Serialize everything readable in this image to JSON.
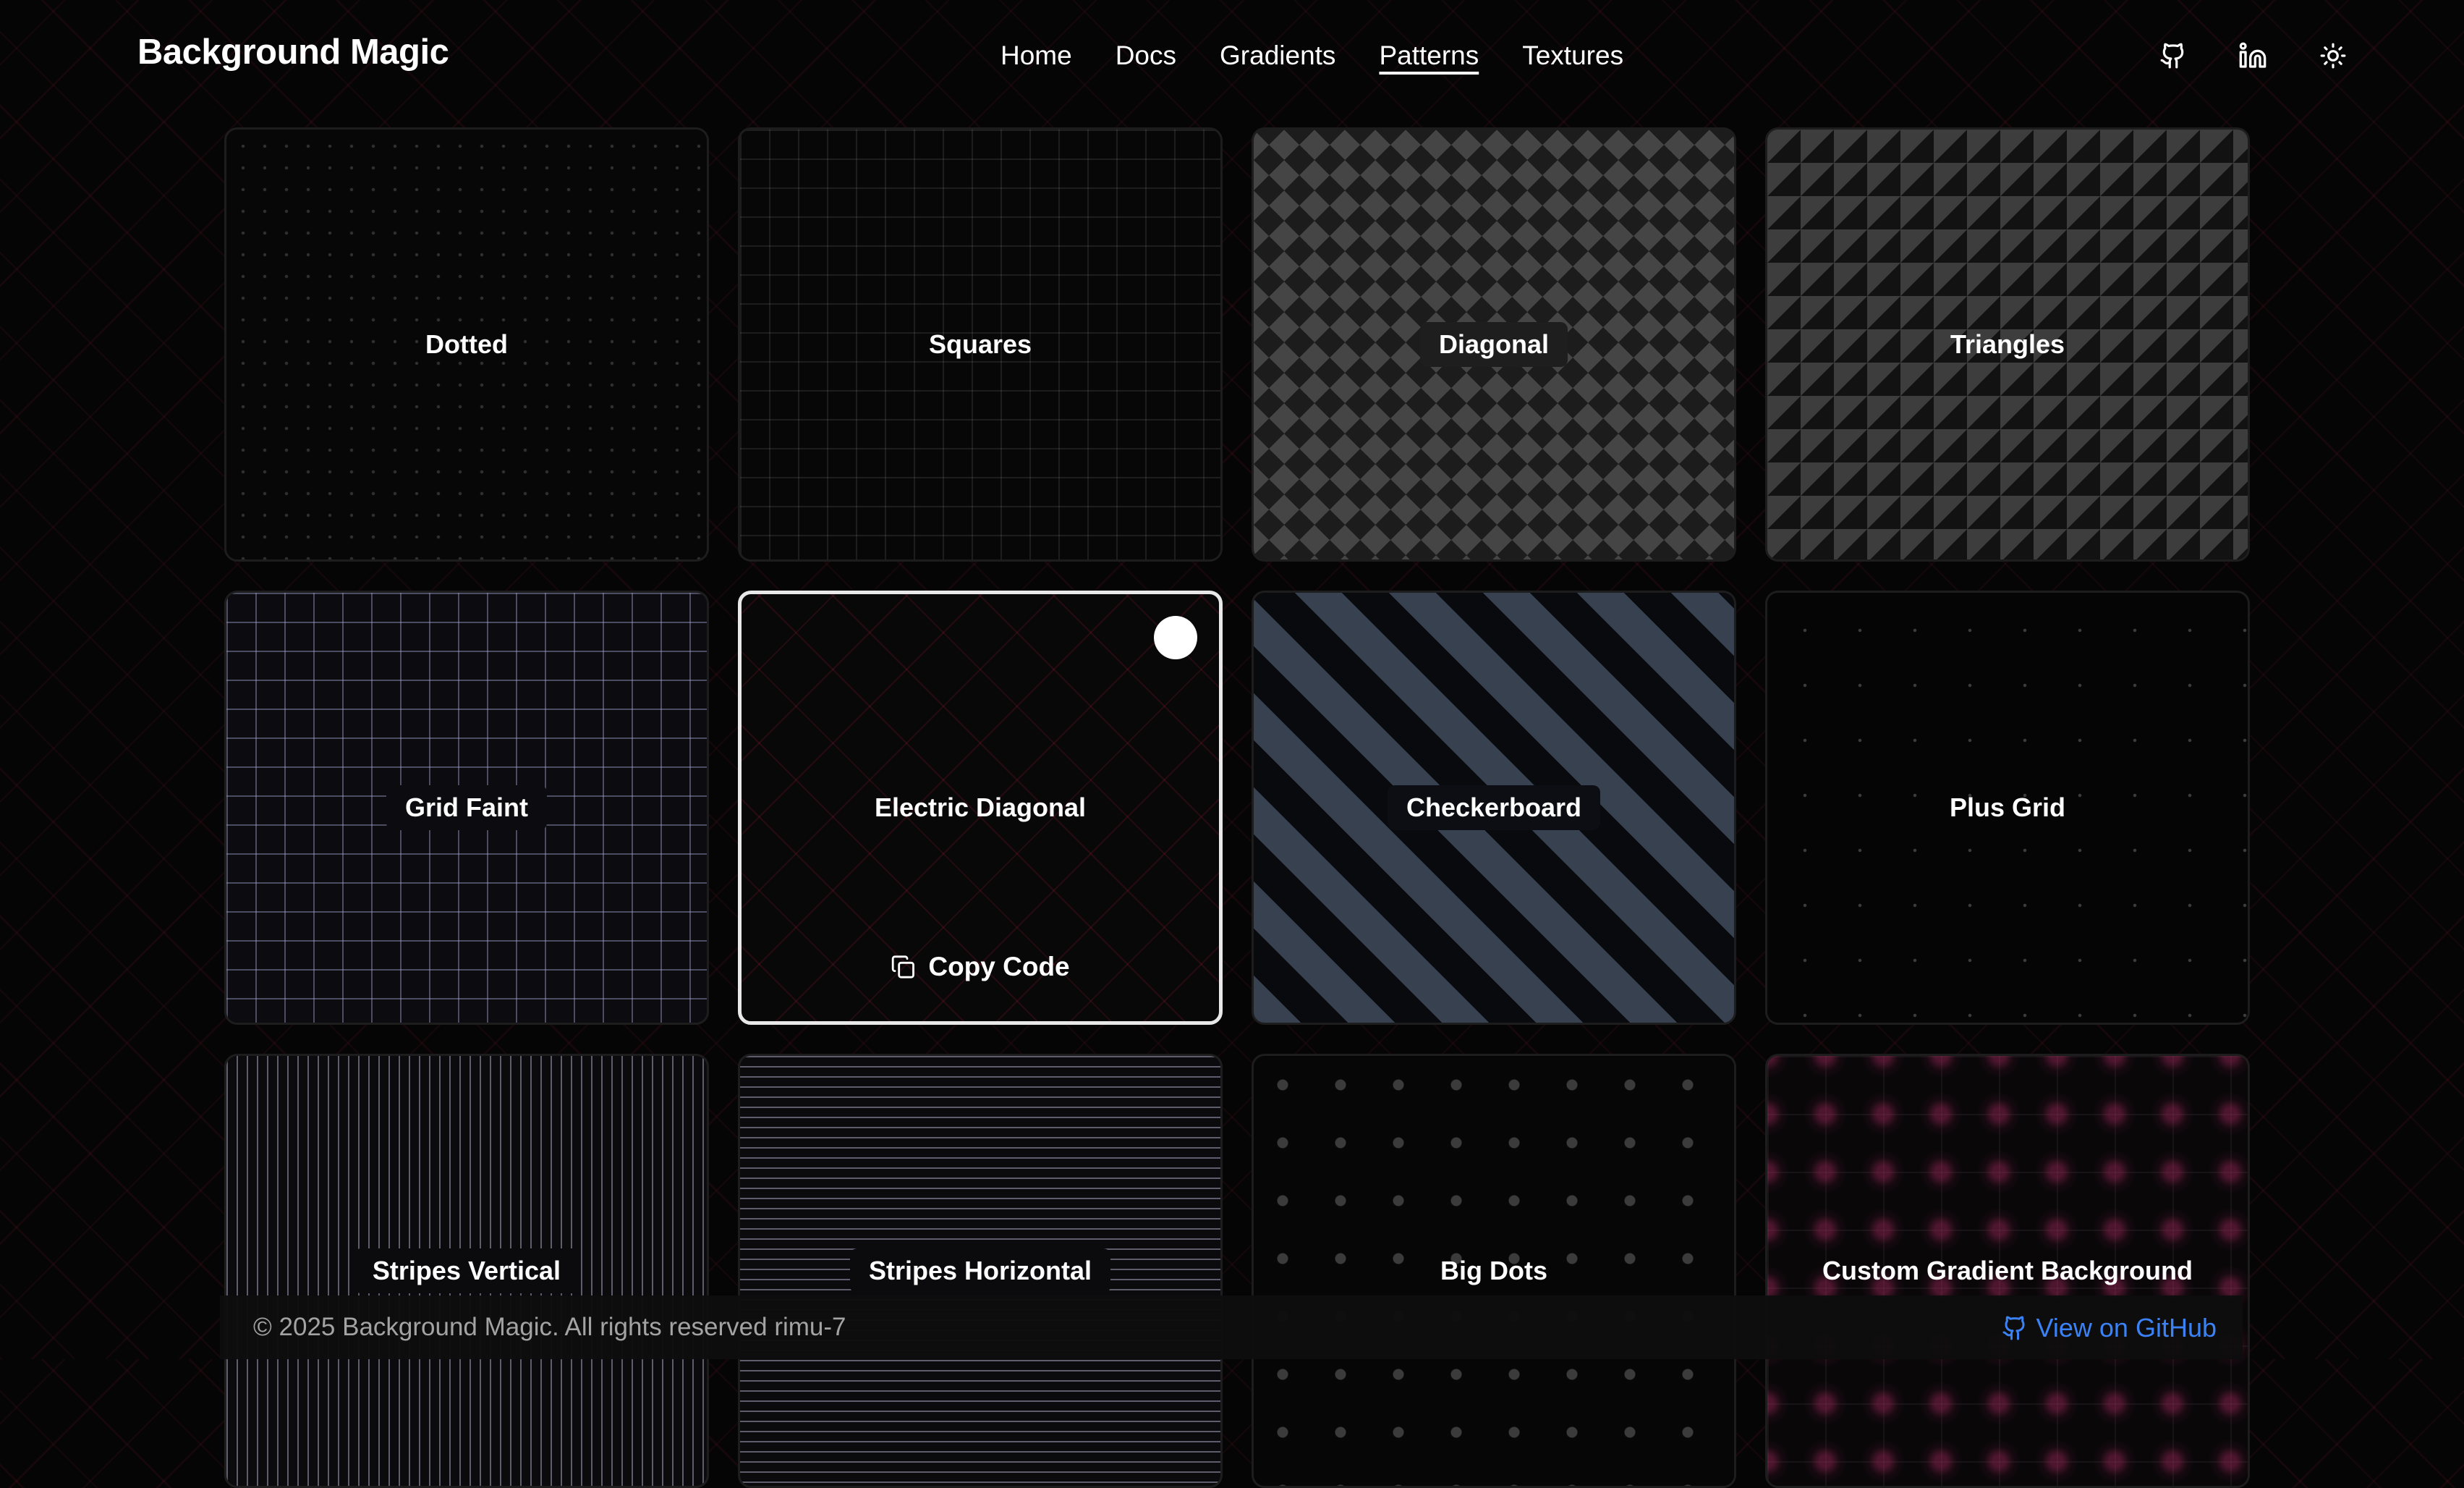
{
  "app": {
    "title": "Background Magic"
  },
  "nav": {
    "items": [
      {
        "label": "Home",
        "active": false
      },
      {
        "label": "Docs",
        "active": false
      },
      {
        "label": "Gradients",
        "active": false
      },
      {
        "label": "Patterns",
        "active": true
      },
      {
        "label": "Textures",
        "active": false
      }
    ]
  },
  "header_icons": {
    "github": "github-icon",
    "linkedin": "linkedin-icon",
    "theme": "sun-icon"
  },
  "patterns": [
    {
      "name": "Dotted"
    },
    {
      "name": "Squares"
    },
    {
      "name": "Diagonal"
    },
    {
      "name": "Triangles"
    },
    {
      "name": "Grid Faint"
    },
    {
      "name": "Electric Diagonal",
      "selected": true
    },
    {
      "name": "Checkerboard"
    },
    {
      "name": "Plus Grid"
    },
    {
      "name": "Stripes Vertical"
    },
    {
      "name": "Stripes Horizontal"
    },
    {
      "name": "Big Dots"
    },
    {
      "name": "Custom Gradient Background"
    }
  ],
  "card_actions": {
    "copy_label": "Copy Code",
    "copy_icon": "copy-icon"
  },
  "footer": {
    "copyright": "© 2025 Background Magic. All rights reserved rimu-7",
    "github_link": "View on GitHub"
  },
  "colors": {
    "background": "#050505",
    "accent_link": "#3b82f6",
    "pattern_red": "#be1e46"
  }
}
